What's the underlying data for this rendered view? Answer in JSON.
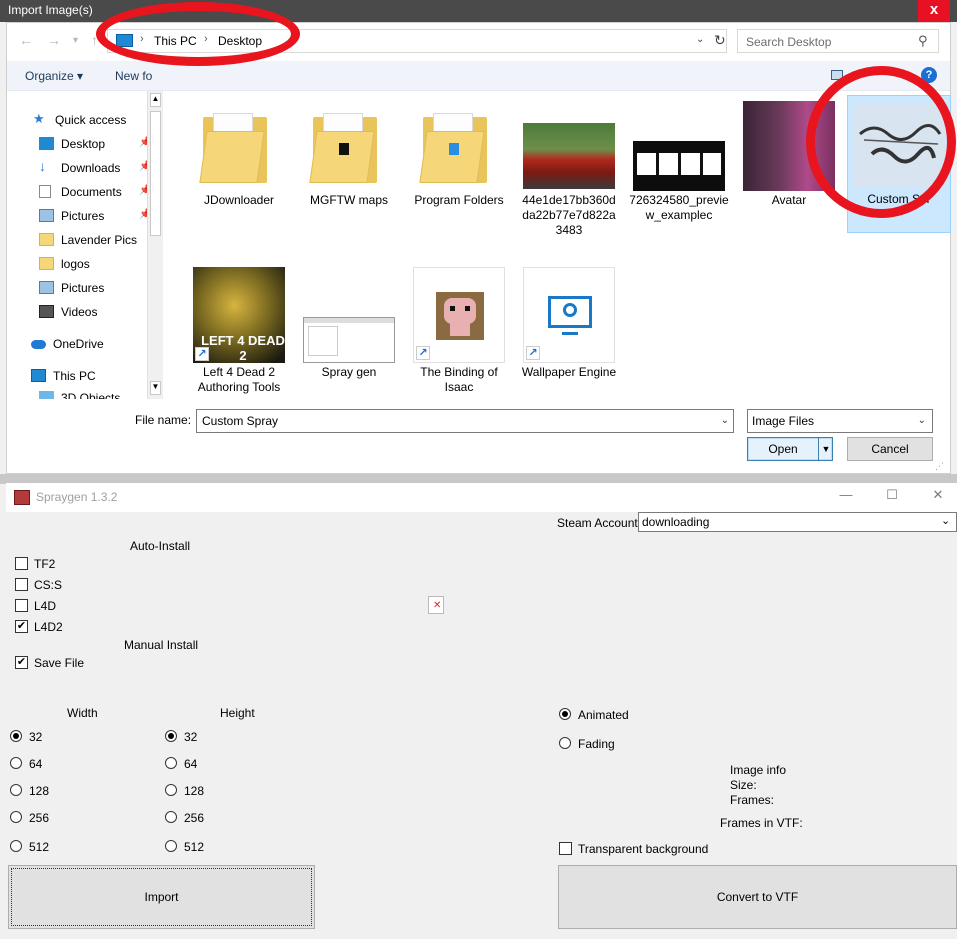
{
  "dialog": {
    "title": "Import Image(s)",
    "close_glyph": "x",
    "breadcrumb": [
      "This PC",
      "Desktop"
    ],
    "search_placeholder": "Search Desktop",
    "organize_label": "Organize",
    "new_folder_label": "New fo",
    "nav_items": [
      {
        "label": "Quick access",
        "icon": "star-icon"
      },
      {
        "label": "Desktop",
        "icon": "desktop-icon",
        "pinned": true
      },
      {
        "label": "Downloads",
        "icon": "download-icon",
        "pinned": true
      },
      {
        "label": "Documents",
        "icon": "documents-icon",
        "pinned": true
      },
      {
        "label": "Pictures",
        "icon": "pictures-icon",
        "pinned": true
      },
      {
        "label": "Lavender Pics",
        "icon": "folder-icon"
      },
      {
        "label": "logos",
        "icon": "folder-icon"
      },
      {
        "label": "Pictures",
        "icon": "pictures-icon"
      },
      {
        "label": "Videos",
        "icon": "videos-icon"
      },
      {
        "label": "OneDrive",
        "icon": "cloud-icon"
      },
      {
        "label": "This PC",
        "icon": "computer-icon"
      },
      {
        "label": "3D Objects",
        "icon": "3d-objects-icon"
      }
    ],
    "files": [
      {
        "name": "JDownloader",
        "kind": "folder"
      },
      {
        "name": "MGFTW maps",
        "kind": "folder"
      },
      {
        "name": "Program Folders",
        "kind": "folder"
      },
      {
        "name": "44e1de17bb360dda22b77e7d822a3483",
        "kind": "image"
      },
      {
        "name": "726324580_preview_examplec",
        "kind": "image"
      },
      {
        "name": "Avatar",
        "kind": "image"
      },
      {
        "name": "Custom Spr",
        "kind": "image",
        "selected": true
      },
      {
        "name": "Left 4 Dead 2 Authoring Tools",
        "kind": "shortcut"
      },
      {
        "name": "Spray gen",
        "kind": "image"
      },
      {
        "name": "The Binding of Isaac",
        "kind": "shortcut"
      },
      {
        "name": "Wallpaper Engine",
        "kind": "shortcut"
      }
    ],
    "file_name_label": "File name:",
    "file_name_value": "Custom Spray",
    "file_type_value": "Image Files",
    "open_label": "Open",
    "cancel_label": "Cancel"
  },
  "app": {
    "title": "Spraygen 1.3.2",
    "steam_account_label": "Steam Account",
    "steam_account_value": "downloading",
    "auto_install_label": "Auto-Install",
    "games": [
      {
        "label": "TF2",
        "checked": false
      },
      {
        "label": "CS:S",
        "checked": false
      },
      {
        "label": "L4D",
        "checked": false
      },
      {
        "label": "L4D2",
        "checked": true
      }
    ],
    "manual_install_label": "Manual Install",
    "save_file_label": "Save File",
    "save_file_checked": true,
    "width_label": "Width",
    "height_label": "Height",
    "sizes": [
      "32",
      "64",
      "128",
      "256",
      "512"
    ],
    "selected_width": "32",
    "selected_height": "32",
    "animated_label": "Animated",
    "fading_label": "Fading",
    "image_info_label": "Image info",
    "size_label": "Size:",
    "frames_label": "Frames:",
    "frames_in_vtf_label": "Frames in VTF:",
    "transparent_bg_label": "Transparent background",
    "import_label": "Import",
    "convert_label": "Convert to VTF"
  },
  "colors": {
    "annotation": "#e8141e",
    "close_red": "#e81123",
    "selection": "#cce8ff"
  }
}
